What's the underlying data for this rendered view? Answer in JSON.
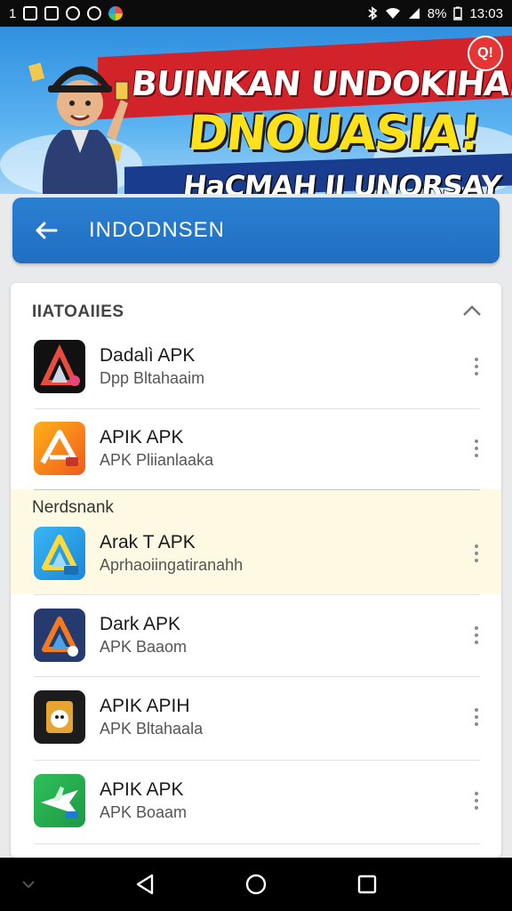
{
  "status_bar": {
    "left_text": "1",
    "battery": "8%",
    "time": "13:03",
    "left_icons": [
      "gallery-icon",
      "messaging-icon",
      "game-icon",
      "settings-icon",
      "chrome-icon"
    ],
    "right_icons": [
      "bluetooth-icon",
      "wifi-icon",
      "signal-icon",
      "battery-icon"
    ]
  },
  "banner": {
    "line1": "BUINKAN UNDOKIHAN",
    "line2": "DNOUASIA!",
    "line3": "HaCMAH II UNORSAY",
    "badge": "Q!",
    "colors": {
      "red": "#d3232a",
      "yellow": "#ffe21a",
      "sky": "#2f8fe0"
    }
  },
  "header": {
    "title": "INDODNSEN",
    "back_icon": "arrow-left-icon",
    "color": "#1f6fc3"
  },
  "section": {
    "title": "IIATOAIIES",
    "sub_title": "Nerdsnank",
    "collapse_icon": "chevron-up-icon"
  },
  "apps": [
    {
      "name": "Dadalì APK",
      "subtitle": "Dpp Bltahaaim",
      "icon": "dark-a-logo-icon"
    },
    {
      "name": "APIK APK",
      "subtitle": "APK Pliianlaaka",
      "icon": "orange-a-logo-icon"
    },
    {
      "name": "Arak T APK",
      "subtitle": "Aprhaoiingatiranahh",
      "icon": "blue-a-logo-icon",
      "highlighted": true
    },
    {
      "name": "Dark APK",
      "subtitle": "APK Baaom",
      "icon": "navy-a-logo-icon"
    },
    {
      "name": "APIK APIH",
      "subtitle": "APK Bltahaala",
      "icon": "ghost-app-icon"
    },
    {
      "name": "APIK APK",
      "subtitle": "APK Boaam",
      "icon": "green-plane-icon"
    }
  ],
  "nav_bar": {
    "buttons": [
      "back-triangle-icon",
      "home-circle-icon",
      "recents-square-icon"
    ]
  }
}
